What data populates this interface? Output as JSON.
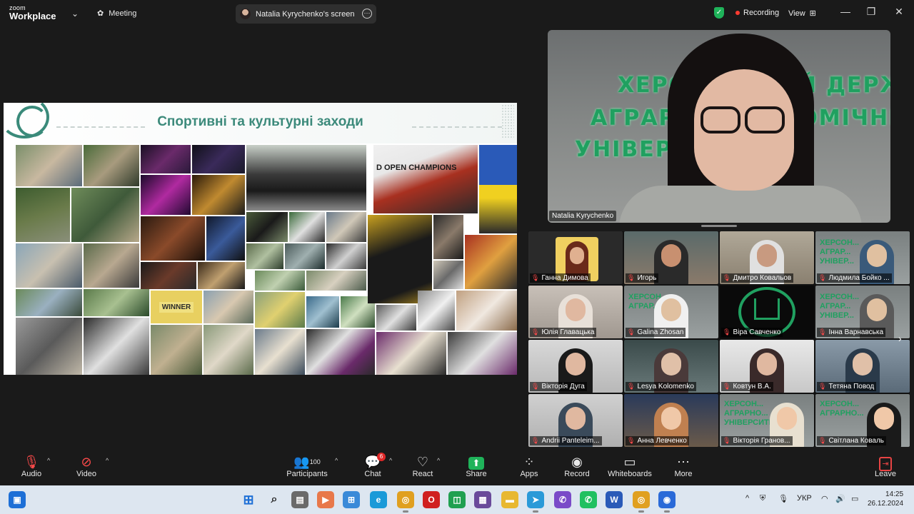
{
  "app": {
    "logo_top": "zoom",
    "logo_bottom": "Workplace",
    "meeting_label": "Meeting",
    "screen_share_label": "Natalia Kyrychenko's screen",
    "recording_label": "Recording",
    "view_label": "View"
  },
  "slide": {
    "title": "Спортивні та культурні заходи",
    "winner_text": "WINNER",
    "banner_text": "D OPEN CHAMPIONS"
  },
  "speaker": {
    "name": "Natalia Kyrychenko",
    "wall_line1": "ХЕРСОНСЬКИЙ ДЕРЖАВНИЙ",
    "wall_line2": "АГРАРНО-ЕКОНОМІЧНИЙ",
    "wall_line3": "УНІВЕРСИТЕТ"
  },
  "participants": [
    {
      "name": "Ганна Димова"
    },
    {
      "name": "Игорь"
    },
    {
      "name": "Дмитро Ковальов"
    },
    {
      "name": "Людмила Бойко ..."
    },
    {
      "name": "Юлія Главацька"
    },
    {
      "name": "Galina Zhosan"
    },
    {
      "name": "Віра Савченко"
    },
    {
      "name": "Інна Варнавська"
    },
    {
      "name": "Вікторія Дуга"
    },
    {
      "name": "Lesya Kolomenko"
    },
    {
      "name": "Ковтун В.А."
    },
    {
      "name": "Тетяна Повод"
    },
    {
      "name": "Andrii Panteleim..."
    },
    {
      "name": "Анна Левченко"
    },
    {
      "name": "Вікторія Гранов..."
    },
    {
      "name": "Світлана Коваль"
    }
  ],
  "toolbar": {
    "audio": "Audio",
    "video": "Video",
    "participants": "Participants",
    "participants_count": "100",
    "chat": "Chat",
    "chat_badge": "6",
    "react": "React",
    "share": "Share",
    "apps": "Apps",
    "record": "Record",
    "whiteboards": "Whiteboards",
    "more": "More",
    "leave": "Leave"
  },
  "taskbar": {
    "language": "УКР",
    "time": "14:25",
    "date": "26.12.2024"
  }
}
